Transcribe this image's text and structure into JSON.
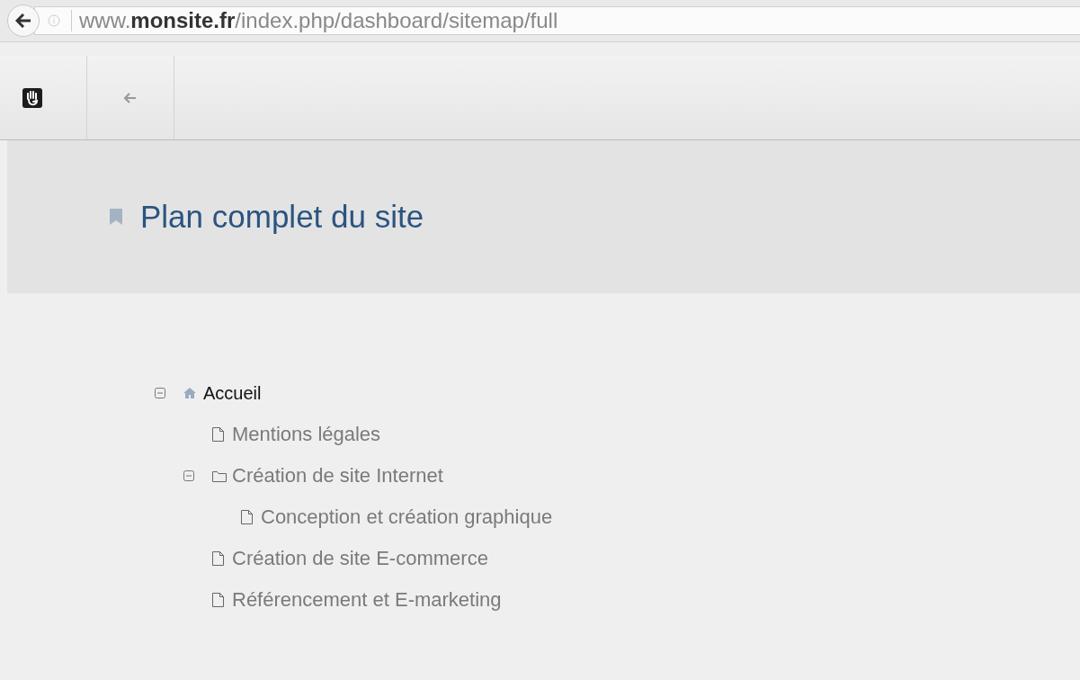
{
  "browser": {
    "url": "www.**monsite.fr**/index.php/dashboard/sitemap/full"
  },
  "header": {
    "title": "Plan complet du site"
  },
  "tree": [
    {
      "label": "Accueil",
      "kind": "home",
      "expanded": true,
      "children": [
        {
          "label": "Mentions légales",
          "kind": "page"
        },
        {
          "label": "Création de site Internet",
          "kind": "folder",
          "expanded": true,
          "children": [
            {
              "label": "Conception et création graphique",
              "kind": "page"
            }
          ]
        },
        {
          "label": "Création de site E-commerce",
          "kind": "page"
        },
        {
          "label": "Référencement et E-marketing",
          "kind": "page"
        }
      ]
    }
  ]
}
